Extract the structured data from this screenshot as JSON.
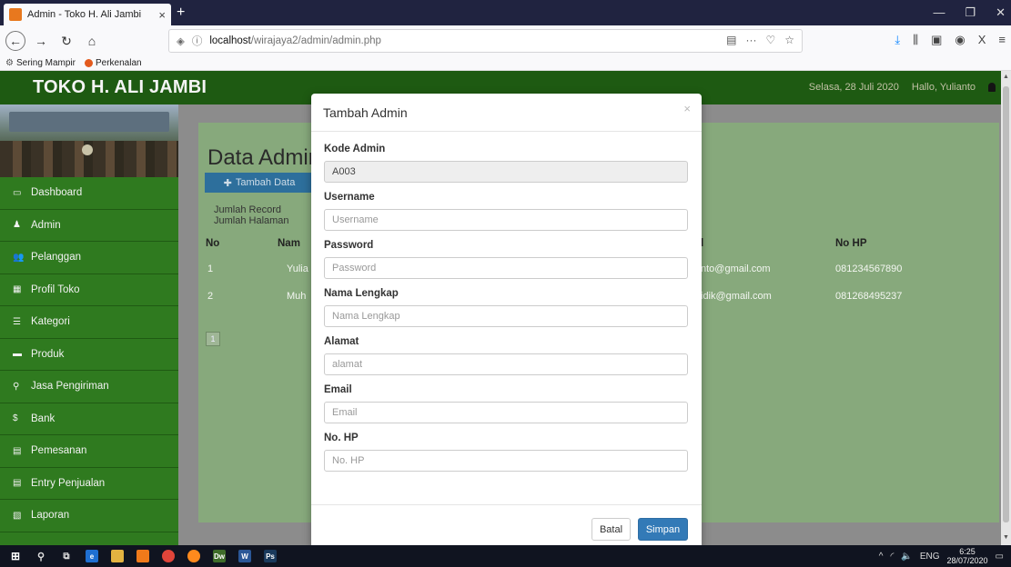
{
  "browser": {
    "tab_title": "Admin - Toko H. Ali Jambi",
    "tab_close": "×",
    "new_tab": "+",
    "url_host": "localhost",
    "url_path": "/wirajaya2/admin/admin.php",
    "bookmarks": [
      "Sering Mampir",
      "Perkenalan"
    ]
  },
  "site": {
    "brand": "TOKO H. ALI JAMBI",
    "date": "Selasa, 28 Juli 2020",
    "greeting": "Hallo, Yulianto"
  },
  "sidebar": {
    "items": [
      {
        "label": "Dashboard",
        "icon": "▭"
      },
      {
        "label": "Admin",
        "icon": "♟"
      },
      {
        "label": "Pelanggan",
        "icon": "👥"
      },
      {
        "label": "Profil Toko",
        "icon": "▦"
      },
      {
        "label": "Kategori",
        "icon": "☰"
      },
      {
        "label": "Produk",
        "icon": "▬"
      },
      {
        "label": "Jasa Pengiriman",
        "icon": "⚲"
      },
      {
        "label": "Bank",
        "icon": "$"
      },
      {
        "label": "Pemesanan",
        "icon": "▤"
      },
      {
        "label": "Entry Penjualan",
        "icon": "▤"
      },
      {
        "label": "Laporan",
        "icon": "▧"
      }
    ]
  },
  "content": {
    "title": "Data Admin",
    "add_button": "Tambah Data",
    "record_label": "Jumlah Record",
    "page_label": "Jumlah Halaman",
    "table": {
      "headers": {
        "no": "No",
        "nama": "Nam",
        "email": "l",
        "hp": "No HP"
      },
      "rows": [
        {
          "no": "1",
          "nama": "Yulia",
          "email": "nto@gmail.com",
          "hp": "081234567890"
        },
        {
          "no": "2",
          "nama": "Muh",
          "email": "idik@gmail.com",
          "hp": "081268495237"
        }
      ]
    },
    "pagination": [
      "1"
    ]
  },
  "modal": {
    "title": "Tambah Admin",
    "close": "×",
    "fields": {
      "kode": {
        "label": "Kode Admin",
        "value": "A003"
      },
      "username": {
        "label": "Username",
        "placeholder": "Username"
      },
      "password": {
        "label": "Password",
        "placeholder": "Password"
      },
      "nama": {
        "label": "Nama Lengkap",
        "placeholder": "Nama Lengkap"
      },
      "alamat": {
        "label": "Alamat",
        "placeholder": "alamat"
      },
      "email": {
        "label": "Email",
        "placeholder": "Email"
      },
      "hp": {
        "label": "No. HP",
        "placeholder": "No. HP"
      }
    },
    "cancel_label": "Batal",
    "save_label": "Simpan"
  },
  "taskbar": {
    "lang": "ENG",
    "time": "6:25",
    "date": "28/07/2020",
    "apps": [
      "Dw",
      "W",
      "Ps"
    ]
  },
  "colors": {
    "header": "#1e5a12",
    "sidebar": "#2f7a1f",
    "content": "#87a97c",
    "primary": "#337ab7"
  }
}
